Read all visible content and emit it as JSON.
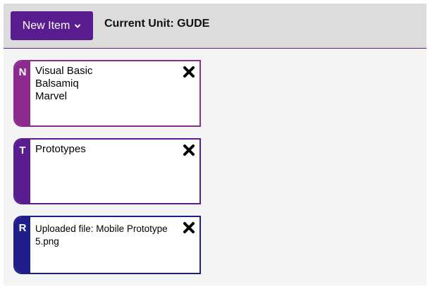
{
  "toolbar": {
    "new_item_label": "New Item",
    "unit_prefix": "Current Unit: ",
    "unit_code": "GUDE"
  },
  "cards": [
    {
      "tag": "N",
      "lines": [
        "Visual Basic",
        "Balsamiq",
        "Marvel"
      ],
      "accent": "#8d2a8f"
    },
    {
      "tag": "T",
      "lines": [
        "Prototypes"
      ],
      "accent": "#5a1d8f"
    },
    {
      "tag": "R",
      "lines": [
        "Uploaded file: Mobile Prototype 5.png"
      ],
      "accent": "#201e8a"
    }
  ],
  "icons": {
    "close": "close-icon",
    "chevron": "chevron-down-icon"
  }
}
